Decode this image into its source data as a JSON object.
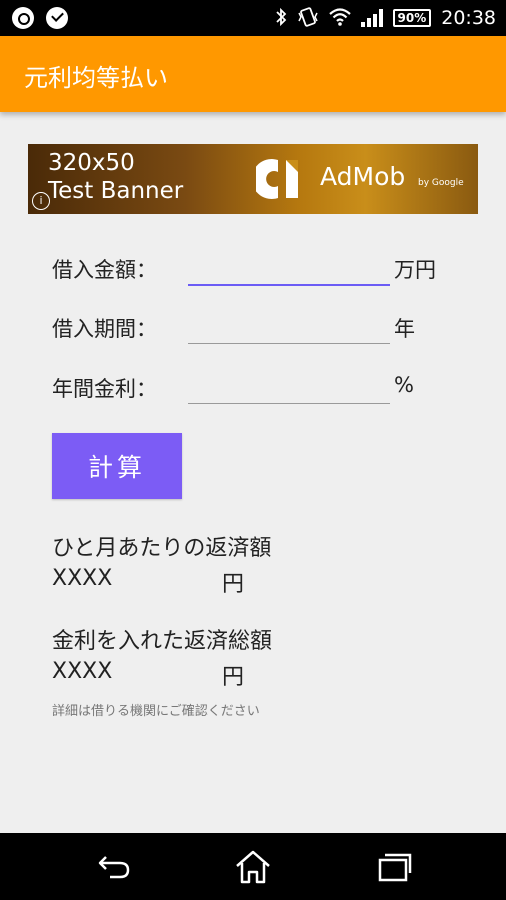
{
  "status_bar": {
    "battery": "90%",
    "time": "20:38"
  },
  "app_bar": {
    "title": "元利均等払い"
  },
  "ad": {
    "line1": "320x50",
    "line2": "Test Banner",
    "brand": "AdMob",
    "by": "by Google",
    "info": "i"
  },
  "form": {
    "amount": {
      "label": "借入金額：",
      "value": "",
      "unit": "万円"
    },
    "period": {
      "label": "借入期間：",
      "value": "",
      "unit": "年"
    },
    "rate": {
      "label": "年間金利：",
      "value": "",
      "unit": "%"
    }
  },
  "calc_button": "計算",
  "results": {
    "monthly": {
      "label": "ひと月あたりの返済額",
      "value": "XXXX",
      "unit": "円"
    },
    "total": {
      "label": "金利を入れた返済総額",
      "value": "XXXX",
      "unit": "円"
    }
  },
  "note": "詳細は借りる機関にご確認ください",
  "icons": {
    "status_left": [
      "circle-app-icon",
      "check-badge-icon"
    ],
    "status_right": [
      "bluetooth-icon",
      "vibrate-icon",
      "wifi-icon",
      "signal-icon",
      "battery-icon"
    ],
    "nav": [
      "back-icon",
      "home-icon",
      "recents-icon"
    ]
  }
}
